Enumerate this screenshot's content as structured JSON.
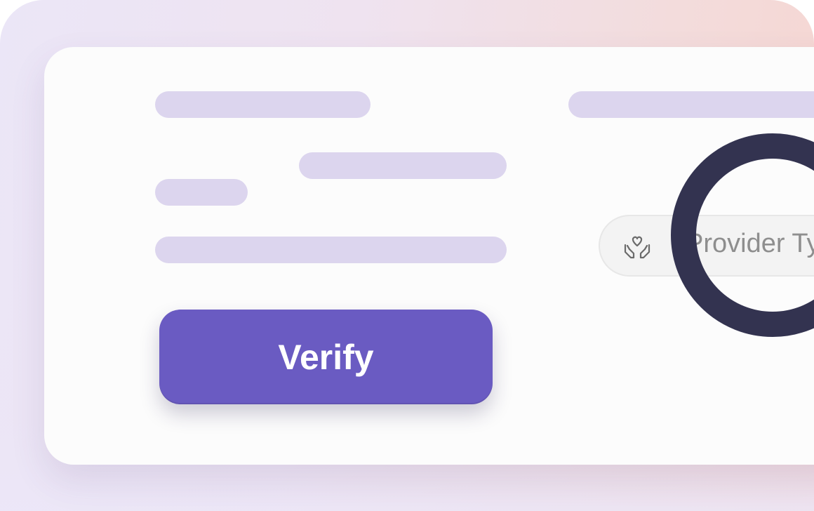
{
  "form": {
    "verify_label": "Verify",
    "provider_type_placeholder": "Provider Type"
  },
  "icons": {
    "provider_icon": "hands-heart-icon",
    "cursor_highlight": "focus-ring"
  },
  "colors": {
    "accent": "#6a5bc2",
    "skeleton": "#dcd5ee",
    "ring": "#333350",
    "card": "#fcfcfc"
  }
}
